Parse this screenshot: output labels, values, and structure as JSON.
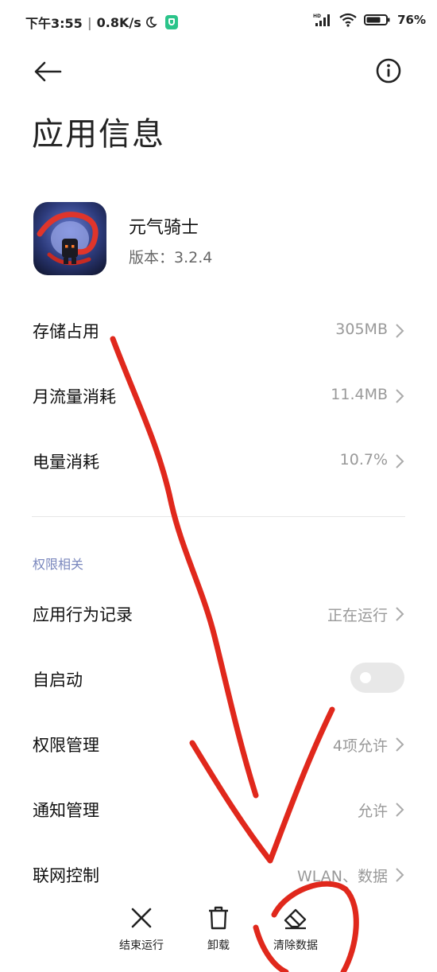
{
  "status_bar": {
    "time": "下午3:55",
    "net_speed": "0.8K/s",
    "battery": "76"
  },
  "header": {
    "title": "应用信息"
  },
  "app": {
    "name": "元气骑士",
    "version": "版本：3.2.4"
  },
  "usage_rows": [
    {
      "label": "存储占用",
      "value": "305MB"
    },
    {
      "label": "月流量消耗",
      "value": "11.4MB"
    },
    {
      "label": "电量消耗",
      "value": "10.7%"
    }
  ],
  "permissions": {
    "section_title": "权限相关",
    "rows": [
      {
        "label": "应用行为记录",
        "value": "正在运行"
      },
      {
        "label": "自启动",
        "toggle_on": false
      },
      {
        "label": "权限管理",
        "value": "4项允许"
      },
      {
        "label": "通知管理",
        "value": "允许"
      },
      {
        "label": "联网控制",
        "value": "WLAN、数据"
      }
    ]
  },
  "actions": [
    {
      "label": "结束运行",
      "icon": "close-icon"
    },
    {
      "label": "卸载",
      "icon": "trash-icon"
    },
    {
      "label": "清除数据",
      "icon": "eraser-icon"
    }
  ],
  "colors": {
    "accent_section": "#7a87bd",
    "annotation_red": "#e0281c",
    "muted_text": "#999999"
  }
}
